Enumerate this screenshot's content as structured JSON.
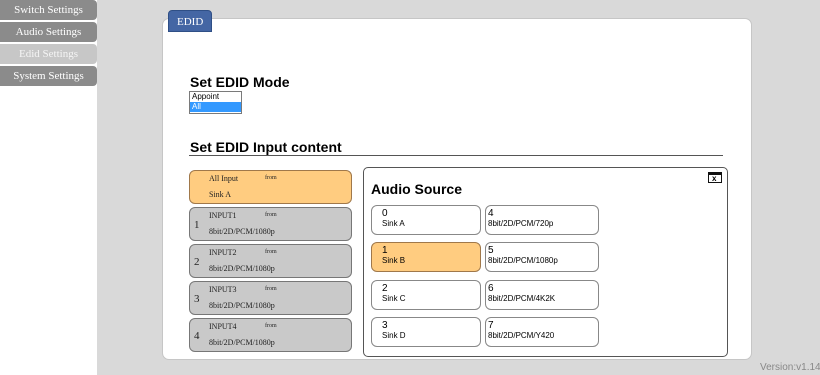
{
  "nav": {
    "items": [
      {
        "label": "Switch Settings"
      },
      {
        "label": "Audio Settings"
      },
      {
        "label": "Edid Settings"
      },
      {
        "label": "System Settings"
      }
    ]
  },
  "tab": {
    "label": "EDID"
  },
  "mode": {
    "title": "Set EDID Mode",
    "options": [
      "Appoint",
      "All"
    ],
    "selected": "All"
  },
  "input_section": {
    "title": "Set EDID Input content"
  },
  "inputs": [
    {
      "num": "",
      "name": "All Input",
      "from": "from",
      "source": "Sink A"
    },
    {
      "num": "1",
      "name": "INPUT1",
      "from": "from",
      "source": "8bit/2D/PCM/1080p"
    },
    {
      "num": "2",
      "name": "INPUT2",
      "from": "from",
      "source": "8bit/2D/PCM/1080p"
    },
    {
      "num": "3",
      "name": "INPUT3",
      "from": "from",
      "source": "8bit/2D/PCM/1080p"
    },
    {
      "num": "4",
      "name": "INPUT4",
      "from": "from",
      "source": "8bit/2D/PCM/1080p"
    }
  ],
  "audio": {
    "title": "Audio Source",
    "close_icon": "close-icon",
    "sources": [
      {
        "idx": "0",
        "label": "Sink A"
      },
      {
        "idx": "1",
        "label": "Sink B"
      },
      {
        "idx": "2",
        "label": "Sink C"
      },
      {
        "idx": "3",
        "label": "Sink D"
      },
      {
        "idx": "4",
        "label": "8bit/2D/PCM/720p"
      },
      {
        "idx": "5",
        "label": "8bit/2D/PCM/1080p"
      },
      {
        "idx": "6",
        "label": "8bit/2D/PCM/4K2K"
      },
      {
        "idx": "7",
        "label": "8bit/2D/PCM/Y420"
      }
    ],
    "selected_idx": "1"
  },
  "footer": {
    "version": "Version:v1.14"
  },
  "colors": {
    "accent": "#4466a4",
    "selected": "#ffcc80",
    "nav": "#8b8b8b"
  }
}
